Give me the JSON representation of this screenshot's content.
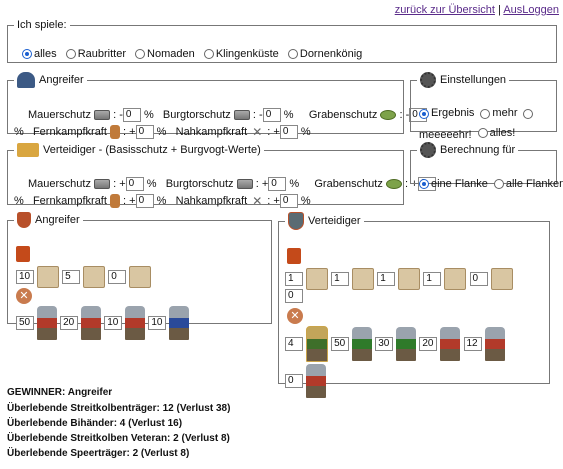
{
  "nav": {
    "back": "zurück zur Übersicht",
    "sep": "|",
    "logout": "AusLoggen"
  },
  "play": {
    "legend": "Ich spiele:",
    "options": [
      "alles",
      "Raubritter",
      "Nomaden",
      "Klingenküste",
      "Dornenkönig"
    ],
    "selected": "alles"
  },
  "attacker_mod": {
    "legend": "Angreifer",
    "mauer_label": "Mauerschutz",
    "mauer_sign": "-",
    "mauer_value": "0",
    "burg_label": "Burgtorschutz",
    "burg_sign": "-",
    "burg_value": "0",
    "graben_label": "Grabenschutz",
    "graben_sign": "-",
    "graben_value": "0",
    "pct": "%",
    "sep": ":",
    "fern_label": "Fernkampfkraft",
    "fern_sign": "+",
    "fern_value": "0",
    "nah_label": "Nahkampfkraft",
    "nah_sign": "+",
    "nah_value": "0"
  },
  "defender_mod": {
    "legend": "Verteidiger - (Basisschutz + Burgvogt-Werte)",
    "mauer_label": "Mauerschutz",
    "mauer_sign": "+",
    "mauer_value": "0",
    "burg_label": "Burgtorschutz",
    "burg_sign": "+",
    "burg_value": "0",
    "graben_label": "Grabenschutz",
    "graben_sign": "+",
    "graben_value": "0",
    "pct": "%",
    "sep": ":",
    "fern_label": "Fernkampfkraft",
    "fern_sign": "+",
    "fern_value": "0",
    "nah_label": "Nahkampfkraft",
    "nah_sign": "+",
    "nah_value": "0"
  },
  "settings": {
    "legend": "Einstellungen",
    "options": [
      "Ergebnis",
      "mehr",
      "meeeeehr!",
      "alles!"
    ],
    "selected": "Ergebnis"
  },
  "calc": {
    "legend": "Berechnung für",
    "options": [
      "eine Flanke",
      "alle Flanken"
    ],
    "selected": "eine Flanke"
  },
  "attacker": {
    "legend": "Angreifer",
    "tools": [
      "10",
      "5",
      "0"
    ],
    "units": [
      "50",
      "20",
      "10",
      "10"
    ]
  },
  "defender": {
    "legend": "Verteidiger",
    "tools": [
      "1",
      "1",
      "1",
      "1",
      "0",
      "0"
    ],
    "units": [
      "4",
      "50",
      "30",
      "20",
      "12",
      "0"
    ]
  },
  "result": {
    "winner": "GEWINNER: Angreifer",
    "lines": [
      "Überlebende Streitkolbenträger: 12 (Verlust 38)",
      "Überlebende Bihänder: 4 (Verlust 16)",
      "Überlebende Streitkolben Veteran: 2 (Verlust 8)",
      "Überlebende Speerträger: 2 (Verlust 8)"
    ]
  },
  "icons": {
    "attacker_helm": "helmet-icon",
    "defender_crown": "crown-icon",
    "gear": "gear-icon",
    "wall": "wall-icon",
    "gate": "gate-icon",
    "ditch": "moat-icon",
    "ranged": "bow-icon",
    "melee": "crossed-swords-icon"
  }
}
